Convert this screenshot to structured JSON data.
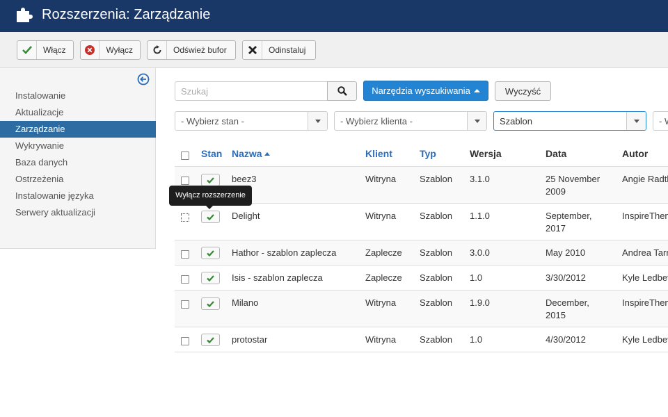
{
  "header": {
    "title": "Rozszerzenia: Zarządzanie",
    "icon": "puzzle-icon"
  },
  "toolbar": {
    "enable_label": "Włącz",
    "disable_label": "Wyłącz",
    "refresh_label": "Odśwież bufor",
    "uninstall_label": "Odinstaluj"
  },
  "sidebar": {
    "items": [
      {
        "label": "Instalowanie"
      },
      {
        "label": "Aktualizacje"
      },
      {
        "label": "Zarządzanie",
        "active": true
      },
      {
        "label": "Wykrywanie"
      },
      {
        "label": "Baza danych"
      },
      {
        "label": "Ostrzeżenia"
      },
      {
        "label": "Instalowanie języka"
      },
      {
        "label": "Serwery aktualizacji"
      }
    ]
  },
  "search": {
    "placeholder": "Szukaj",
    "tools_label": "Narzędzia wyszukiwania",
    "clear_label": "Wyczyść"
  },
  "filters": {
    "state": "- Wybierz stan -",
    "client": "- Wybierz klienta -",
    "type": "Szablon",
    "next": "- W"
  },
  "table": {
    "headers": {
      "state": "Stan",
      "name": "Nazwa",
      "client": "Klient",
      "type": "Typ",
      "version": "Wersja",
      "date": "Data",
      "author": "Autor"
    },
    "rows": [
      {
        "name": "beez3",
        "client": "Witryna",
        "type": "Szablon",
        "version": "3.1.0",
        "date": "25 November 2009",
        "author": "Angie Radtke"
      },
      {
        "name": "Delight",
        "client": "Witryna",
        "type": "Szablon",
        "version": "1.1.0",
        "date": "September, 2017",
        "author": "InspireTheme"
      },
      {
        "name": "Hathor - szablon zaplecza",
        "client": "Zaplecze",
        "type": "Szablon",
        "version": "3.0.0",
        "date": "May 2010",
        "author": "Andrea Tarr"
      },
      {
        "name": "Isis - szablon zaplecza",
        "client": "Zaplecze",
        "type": "Szablon",
        "version": "1.0",
        "date": "3/30/2012",
        "author": "Kyle Ledbetter"
      },
      {
        "name": "Milano",
        "client": "Witryna",
        "type": "Szablon",
        "version": "1.9.0",
        "date": "December, 2015",
        "author": "InspireTheme"
      },
      {
        "name": "protostar",
        "client": "Witryna",
        "type": "Szablon",
        "version": "1.0",
        "date": "4/30/2012",
        "author": "Kyle Ledbetter"
      }
    ]
  },
  "tooltip": {
    "text": "Wyłącz rozszerzenie"
  },
  "colors": {
    "header_bg": "#1a3867",
    "accent": "#2384d3",
    "active_nav": "#2d6ca2",
    "enabled_check": "#3a8a3a",
    "disabled_x": "#c9302c"
  }
}
